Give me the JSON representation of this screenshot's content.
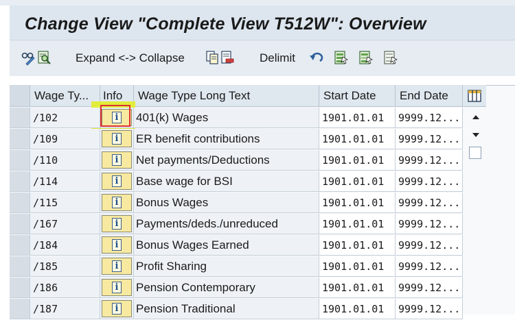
{
  "title": "Change View \"Complete View T512W\": Overview",
  "toolbar": {
    "icons": [
      "glasses-pencil-icon",
      "find-icon",
      "copy-icon",
      "delete-icon",
      "undo-icon",
      "select-all-icon",
      "select-block-icon",
      "deselect-all-icon"
    ],
    "expand_collapse_label": "Expand <-> Collapse",
    "delimit_label": "Delimit"
  },
  "table": {
    "columns": [
      "Wage Ty...",
      "Info",
      "Wage Type Long Text",
      "Start Date",
      "End Date"
    ],
    "rows": [
      {
        "code": "/102",
        "text": "401(k) Wages",
        "start": "1901.01.01",
        "end": "9999.12..."
      },
      {
        "code": "/109",
        "text": "ER benefit contributions",
        "start": "1901.01.01",
        "end": "9999.12..."
      },
      {
        "code": "/110",
        "text": "Net payments/Deductions",
        "start": "1901.01.01",
        "end": "9999.12..."
      },
      {
        "code": "/114",
        "text": "Base wage for BSI",
        "start": "1901.01.01",
        "end": "9999.12..."
      },
      {
        "code": "/115",
        "text": "Bonus Wages",
        "start": "1901.01.01",
        "end": "9999.12..."
      },
      {
        "code": "/167",
        "text": "Payments/deds./unreduced",
        "start": "1901.01.01",
        "end": "9999.12..."
      },
      {
        "code": "/184",
        "text": "Bonus Wages Earned",
        "start": "1901.01.01",
        "end": "9999.12..."
      },
      {
        "code": "/185",
        "text": "Profit Sharing",
        "start": "1901.01.01",
        "end": "9999.12..."
      },
      {
        "code": "/186",
        "text": "Pension Contemporary",
        "start": "1901.01.01",
        "end": "9999.12..."
      },
      {
        "code": "/187",
        "text": "Pension Traditional",
        "start": "1901.01.01",
        "end": "9999.12..."
      }
    ],
    "info_glyph": "i",
    "highlighted_row": 0
  },
  "colors": {
    "title_bg": "#dde6ef",
    "header_bg": "#dfe7ef",
    "info_button": "#f7e9a0",
    "highlight": "#e2ec3b",
    "highlight_border": "#dd3333"
  }
}
